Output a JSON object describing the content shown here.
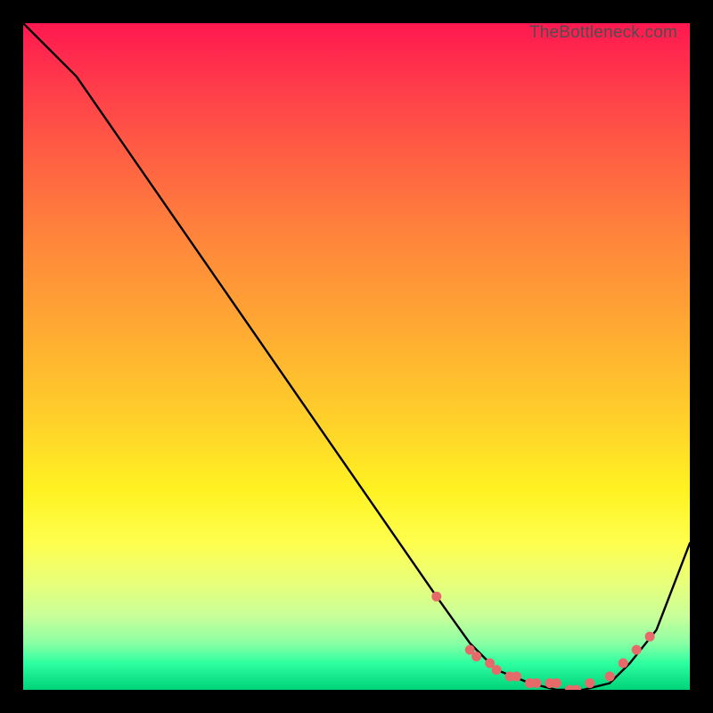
{
  "attribution": "TheBottleneck.com",
  "chart_data": {
    "type": "line",
    "title": "",
    "xlabel": "",
    "ylabel": "",
    "xlim": [
      0,
      100
    ],
    "ylim": [
      0,
      100
    ],
    "series": [
      {
        "name": "bottleneck-curve",
        "x": [
          0,
          8,
          62,
          67,
          71,
          76,
          80,
          84,
          88,
          91,
          95,
          100
        ],
        "y": [
          100,
          92,
          14,
          7,
          3,
          1,
          0,
          0,
          1,
          4,
          9,
          22
        ]
      }
    ],
    "markers": {
      "name": "bottleneck-markers",
      "x": [
        62,
        67,
        68,
        70,
        71,
        73,
        74,
        76,
        77,
        79,
        80,
        82,
        83,
        85,
        88,
        90,
        92,
        94
      ],
      "y": [
        14,
        6,
        5,
        4,
        3,
        2,
        2,
        1,
        1,
        1,
        1,
        0,
        0,
        1,
        2,
        4,
        6,
        8
      ]
    },
    "colors": {
      "curve": "#000000",
      "marker": "#e76a6a"
    }
  }
}
